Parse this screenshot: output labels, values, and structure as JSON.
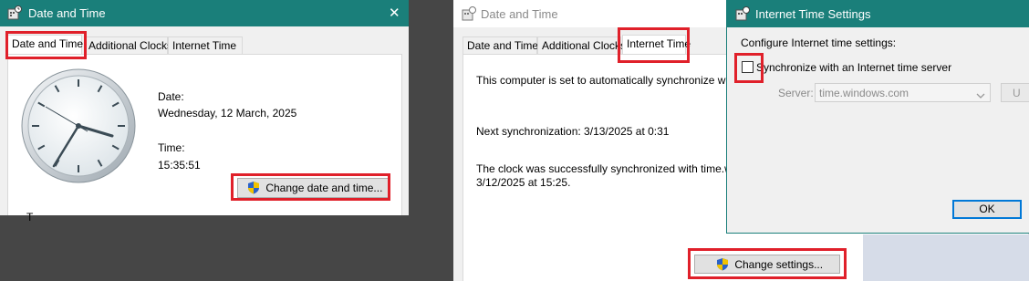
{
  "left_window": {
    "title": "Date and Time",
    "close_glyph": "✕",
    "tabs": [
      "Date and Time",
      "Additional Clocks",
      "Internet Time"
    ],
    "date_label": "Date:",
    "date_value": "Wednesday, 12 March, 2025",
    "time_label": "Time:",
    "time_value": "15:35:51",
    "change_button": "Change date and time...",
    "partial_text": "T"
  },
  "middle_window": {
    "title": "Date and Time",
    "tabs": [
      "Date and Time",
      "Additional Clocks",
      "Internet Time"
    ],
    "sync_line": "This computer is set to automatically synchronize wi",
    "next_sync": "Next synchronization: 3/13/2025 at 0:31",
    "success_line1": "The clock was successfully synchronized with time.w",
    "success_line2": "3/12/2025 at 15:25.",
    "change_settings_button": "Change settings..."
  },
  "dialog": {
    "title": "Internet Time Settings",
    "configure_label": "Configure Internet time settings:",
    "sync_checkbox_label": "Synchronize with an Internet time server",
    "sync_checked": false,
    "server_label": "Server:",
    "server_value": "time.windows.com",
    "update_button": "U",
    "ok_button": "OK"
  },
  "colors": {
    "titlebar": "#1a7f7a",
    "highlight": "#e0202a",
    "background": "#464646"
  }
}
